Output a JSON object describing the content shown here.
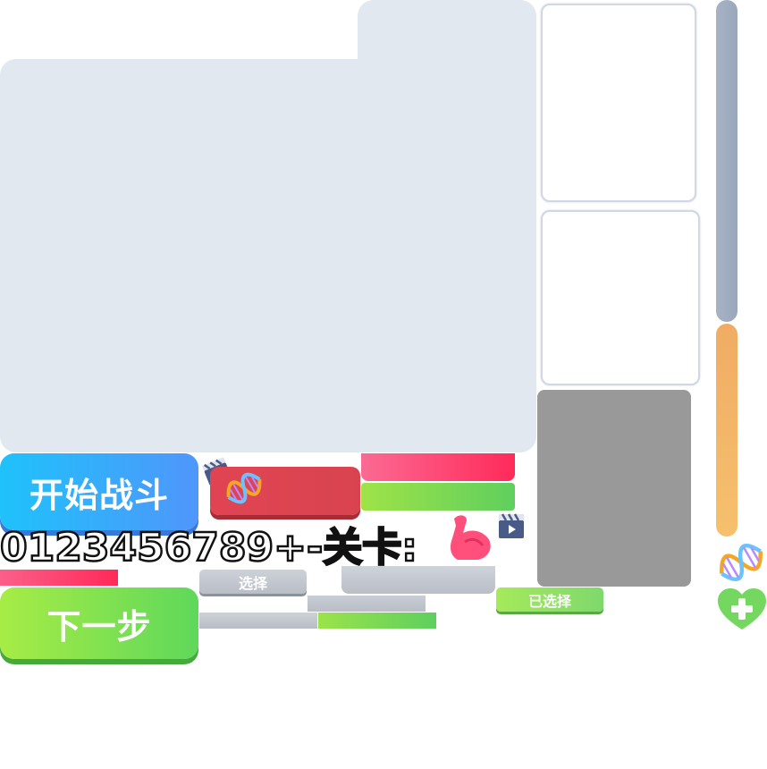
{
  "buttons": {
    "start_battle": "开始战斗",
    "next_step": "下一步",
    "select": "选择",
    "selected": "已选择"
  },
  "font_sheet": {
    "glyphs": "0123456789+-关卡:"
  },
  "icons": {
    "clapper": "clapperboard-icon",
    "dna": "dna-icon",
    "muscle": "flexed-biceps-icon",
    "heal": "heart-plus-icon"
  },
  "colors": {
    "panel": "#e2e8f0",
    "blue_button": "#4f96fb",
    "green_button": "#5fd85b",
    "red_button": "#d9434f",
    "pink_bar": "#ff2a5a",
    "orange_bar": "#f0ac64",
    "gray_card": "#999999"
  }
}
